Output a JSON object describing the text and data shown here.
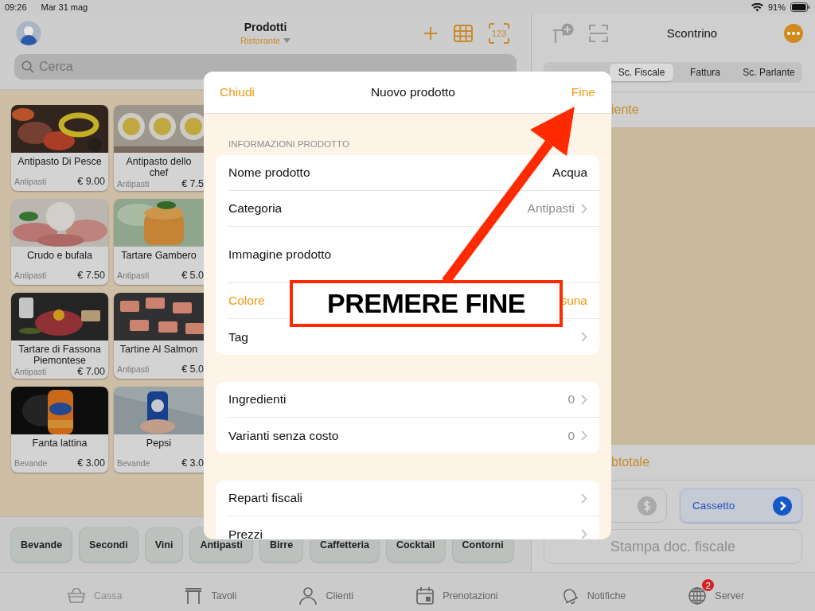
{
  "status_bar": {
    "time": "09:26",
    "date": "Mar 31 mag",
    "battery": "91%"
  },
  "products_header": {
    "title": "Prodotti",
    "subtitle": "Ristorante",
    "keypad_label": "123"
  },
  "search": {
    "placeholder": "Cerca"
  },
  "products": [
    {
      "name": "Antipasto Di Pesce",
      "category": "Antipasti",
      "price": "€ 9.00"
    },
    {
      "name": "Antipasto dello chef",
      "category": "Antipasti",
      "price": "€ 7.5"
    },
    {
      "name": "Crudo e bufala",
      "category": "Antipasti",
      "price": "€ 7.50"
    },
    {
      "name": "Tartare Gambero",
      "category": "Antipasti",
      "price": "€ 5.0"
    },
    {
      "name": "Tartare di Fassona Piemontese",
      "category": "Antipasti",
      "price": "€ 7.00"
    },
    {
      "name": "Tartine Al Salmon",
      "category": "Antipasti",
      "price": "€ 5.0"
    },
    {
      "name": "Fanta lattina",
      "category": "Bevande",
      "price": "€ 3.00"
    },
    {
      "name": "Pepsi",
      "category": "Bevande",
      "price": "€ 3.0"
    }
  ],
  "categories": [
    "Bevande",
    "Secondi",
    "Vini",
    "Antipasti",
    "Birre",
    "Caffetteria",
    "Cocktail",
    "Contorni"
  ],
  "receipt": {
    "title": "Scontrino",
    "tabs": [
      {
        "label": "Sc. Fiscale",
        "selected": true
      },
      {
        "label": "Fattura",
        "selected": false
      },
      {
        "label": "Sc. Parlante",
        "selected": false
      }
    ],
    "customer_label": "iente",
    "subtotal_label": "btotale",
    "drawer_button": "Cassetto",
    "print_button": {
      "label": "Stampa doc. fiscale",
      "disabled": true
    }
  },
  "modal": {
    "cancel": "Chiudi",
    "title": "Nuovo prodotto",
    "done": "Fine",
    "section_header": "INFORMAZIONI PRODOTTO",
    "groups": [
      [
        {
          "kind": "text",
          "label": "Nome prodotto",
          "value": "Acqua"
        },
        {
          "kind": "disclosure",
          "label": "Categoria",
          "value": "Antipasti"
        },
        {
          "label": "Immagine prodotto"
        },
        {
          "kind": "color",
          "label": "Colore",
          "value": "suna"
        },
        {
          "kind": "disclosure",
          "label": "Tag"
        }
      ],
      [
        {
          "kind": "disclosure",
          "label": "Ingredienti",
          "value": "0"
        },
        {
          "kind": "disclosure",
          "label": "Varianti senza costo",
          "value": "0"
        }
      ],
      [
        {
          "kind": "disclosure",
          "label": "Reparti fiscali"
        },
        {
          "kind": "disclosure",
          "label": "Prezzi"
        }
      ]
    ]
  },
  "annotation": {
    "text": "PREMERE FINE"
  },
  "tab_bar": [
    {
      "label": "Cassa",
      "selected": true
    },
    {
      "label": "Tavoli",
      "selected": false
    },
    {
      "label": "Clienti",
      "selected": false
    },
    {
      "label": "Prenotazioni",
      "selected": false
    },
    {
      "label": "Notifiche",
      "selected": false
    },
    {
      "label": "Server",
      "selected": false,
      "badge": "2"
    }
  ]
}
